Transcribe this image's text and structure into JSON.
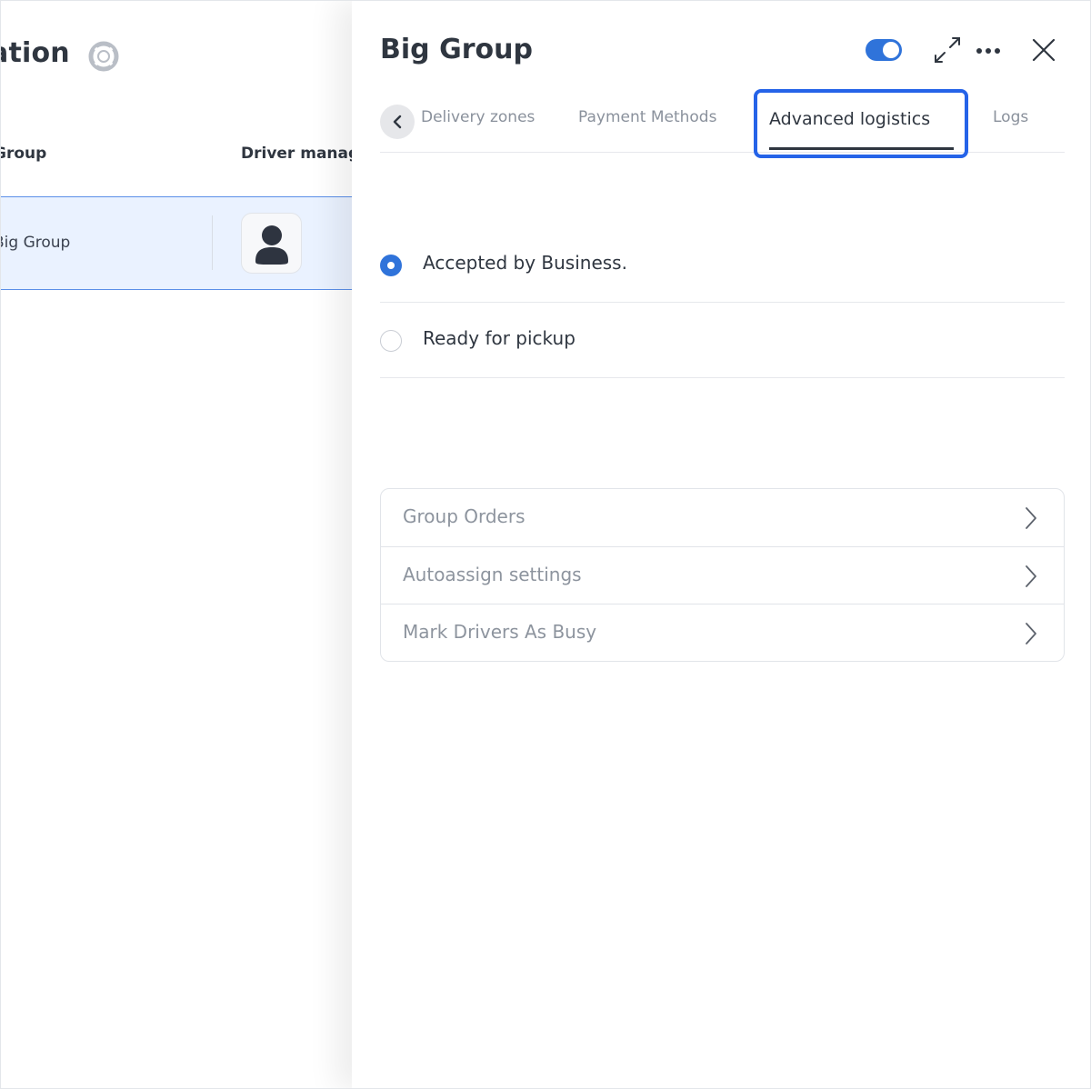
{
  "background": {
    "title": "ation",
    "columns": {
      "group": "Group",
      "driver_manager": "Driver manag"
    },
    "row": {
      "group_name": "Big Group"
    }
  },
  "drawer": {
    "title": "Big Group",
    "toggle_on": true,
    "tabs": [
      {
        "label": "Delivery zones",
        "active": false
      },
      {
        "label": "Payment Methods",
        "active": false
      },
      {
        "label": "Advanced logistics",
        "active": true
      },
      {
        "label": "Logs",
        "active": false
      }
    ],
    "radio_options": [
      {
        "label": "Accepted by Business.",
        "checked": true
      },
      {
        "label": "Ready for pickup",
        "checked": false
      }
    ],
    "settings_items": [
      {
        "label": "Group Orders"
      },
      {
        "label": "Autoassign settings"
      },
      {
        "label": "Mark Drivers As Busy"
      }
    ]
  },
  "colors": {
    "accent": "#2f73da",
    "highlight": "#2563e8",
    "selected_row": "#eaf2ff",
    "text_dark": "#2f3640",
    "text_muted": "#8d949e"
  },
  "icons": {
    "help": "lifebuoy-icon",
    "avatar": "user-icon",
    "expand": "expand-icon",
    "more": "more-horizontal-icon",
    "close": "close-icon",
    "back": "chevron-left-icon",
    "row_arrow": "chevron-right-icon"
  }
}
